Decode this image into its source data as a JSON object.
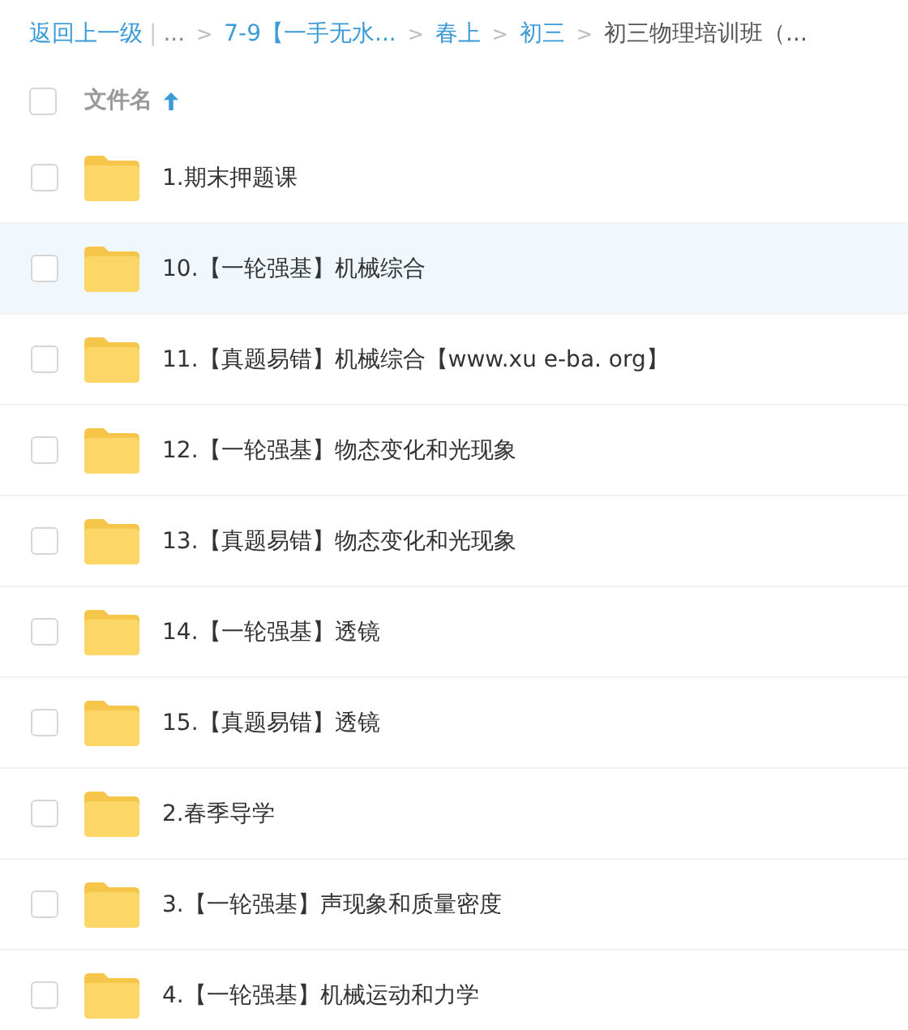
{
  "breadcrumb": {
    "back": "返回上一级",
    "divider": "|",
    "items": [
      {
        "text": "...",
        "kind": "ellipsis"
      },
      {
        "text": "7-9【一手无水...",
        "kind": "link"
      },
      {
        "text": "春上",
        "kind": "link"
      },
      {
        "text": "初三",
        "kind": "link"
      },
      {
        "text": "初三物理培训班（...",
        "kind": "current"
      }
    ],
    "separators": [
      ">",
      ">",
      ">",
      ">"
    ]
  },
  "header": {
    "checked": false,
    "column": "文件名",
    "sort_ascending": true
  },
  "rows": [
    {
      "name": "1.期末押题课",
      "checked": false,
      "highlighted": false
    },
    {
      "name": "10.【一轮强基】机械综合",
      "checked": false,
      "highlighted": true
    },
    {
      "name": "11.【真题易错】机械综合【www.xu e-ba. org】",
      "checked": false,
      "highlighted": false
    },
    {
      "name": "12.【一轮强基】物态变化和光现象",
      "checked": false,
      "highlighted": false
    },
    {
      "name": "13.【真题易错】物态变化和光现象",
      "checked": false,
      "highlighted": false
    },
    {
      "name": "14.【一轮强基】透镜",
      "checked": false,
      "highlighted": false
    },
    {
      "name": "15.【真题易错】透镜",
      "checked": false,
      "highlighted": false
    },
    {
      "name": "2.春季导学",
      "checked": false,
      "highlighted": false
    },
    {
      "name": "3.【一轮强基】声现象和质量密度",
      "checked": false,
      "highlighted": false
    },
    {
      "name": "4.【一轮强基】机械运动和力学",
      "checked": false,
      "highlighted": false
    }
  ]
}
